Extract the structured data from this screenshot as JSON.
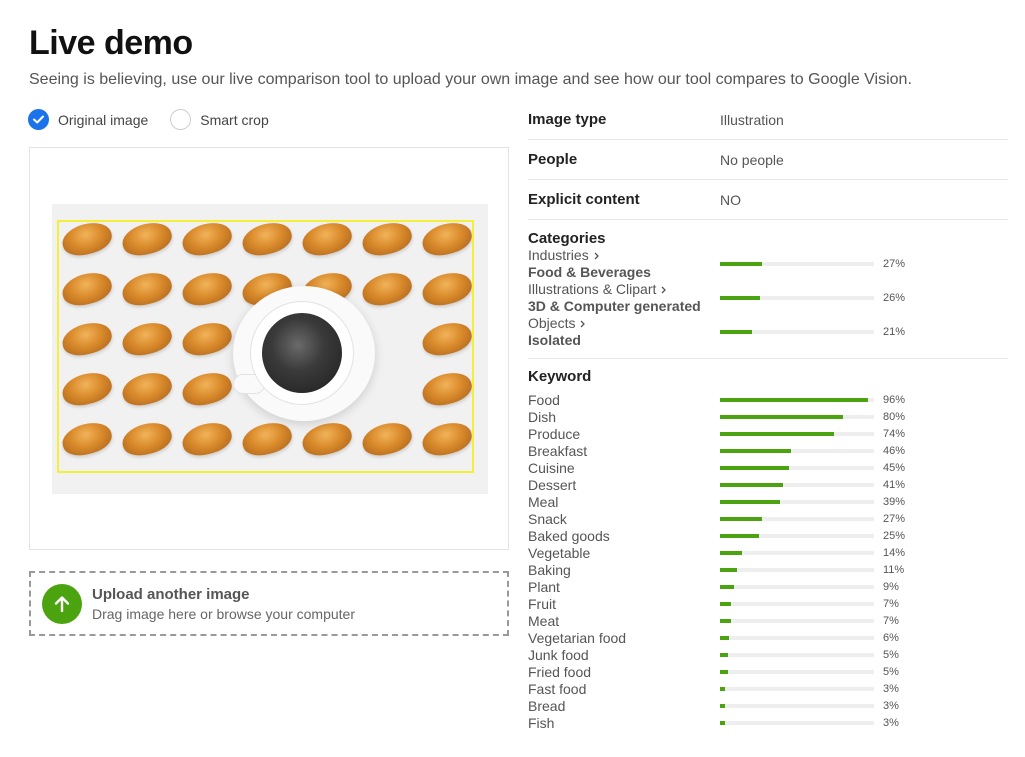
{
  "header": {
    "title": "Live demo",
    "subtitle": "Seeing is believing, use our live comparison tool to upload your own image and see how our tool compares to Google Vision."
  },
  "view_options": {
    "original_label": "Original image",
    "original_checked": true,
    "smart_crop_label": "Smart crop",
    "smart_crop_checked": false
  },
  "upload": {
    "title": "Upload another image",
    "subtitle": "Drag image here or browse your computer"
  },
  "info": {
    "image_type_label": "Image type",
    "image_type_value": "Illustration",
    "people_label": "People",
    "people_value": "No people",
    "explicit_label": "Explicit content",
    "explicit_value": "NO"
  },
  "categories": {
    "title": "Categories",
    "items": [
      {
        "parent": "Industries",
        "child": "Food & Beverages",
        "percent": 27,
        "percent_label": "27%"
      },
      {
        "parent": "Illustrations & Clipart",
        "child": "3D & Computer generated",
        "percent": 26,
        "percent_label": "26%"
      },
      {
        "parent": "Objects",
        "child": "Isolated",
        "percent": 21,
        "percent_label": "21%"
      }
    ]
  },
  "keywords": {
    "title": "Keyword",
    "items": [
      {
        "label": "Food",
        "percent": 96,
        "percent_label": "96%"
      },
      {
        "label": "Dish",
        "percent": 80,
        "percent_label": "80%"
      },
      {
        "label": "Produce",
        "percent": 74,
        "percent_label": "74%"
      },
      {
        "label": "Breakfast",
        "percent": 46,
        "percent_label": "46%"
      },
      {
        "label": "Cuisine",
        "percent": 45,
        "percent_label": "45%"
      },
      {
        "label": "Dessert",
        "percent": 41,
        "percent_label": "41%"
      },
      {
        "label": "Meal",
        "percent": 39,
        "percent_label": "39%"
      },
      {
        "label": "Snack",
        "percent": 27,
        "percent_label": "27%"
      },
      {
        "label": "Baked goods",
        "percent": 25,
        "percent_label": "25%"
      },
      {
        "label": "Vegetable",
        "percent": 14,
        "percent_label": "14%"
      },
      {
        "label": "Baking",
        "percent": 11,
        "percent_label": "11%"
      },
      {
        "label": "Plant",
        "percent": 9,
        "percent_label": "9%"
      },
      {
        "label": "Fruit",
        "percent": 7,
        "percent_label": "7%"
      },
      {
        "label": "Meat",
        "percent": 7,
        "percent_label": "7%"
      },
      {
        "label": "Vegetarian food",
        "percent": 6,
        "percent_label": "6%"
      },
      {
        "label": "Junk food",
        "percent": 5,
        "percent_label": "5%"
      },
      {
        "label": "Fried food",
        "percent": 5,
        "percent_label": "5%"
      },
      {
        "label": "Fast food",
        "percent": 3,
        "percent_label": "3%"
      },
      {
        "label": "Bread",
        "percent": 3,
        "percent_label": "3%"
      },
      {
        "label": "Fish",
        "percent": 3,
        "percent_label": "3%"
      }
    ]
  },
  "colors": {
    "accent_blue": "#1a73e8",
    "bar_green": "#4aa30f",
    "crop_yellow": "#f3ef3a"
  }
}
